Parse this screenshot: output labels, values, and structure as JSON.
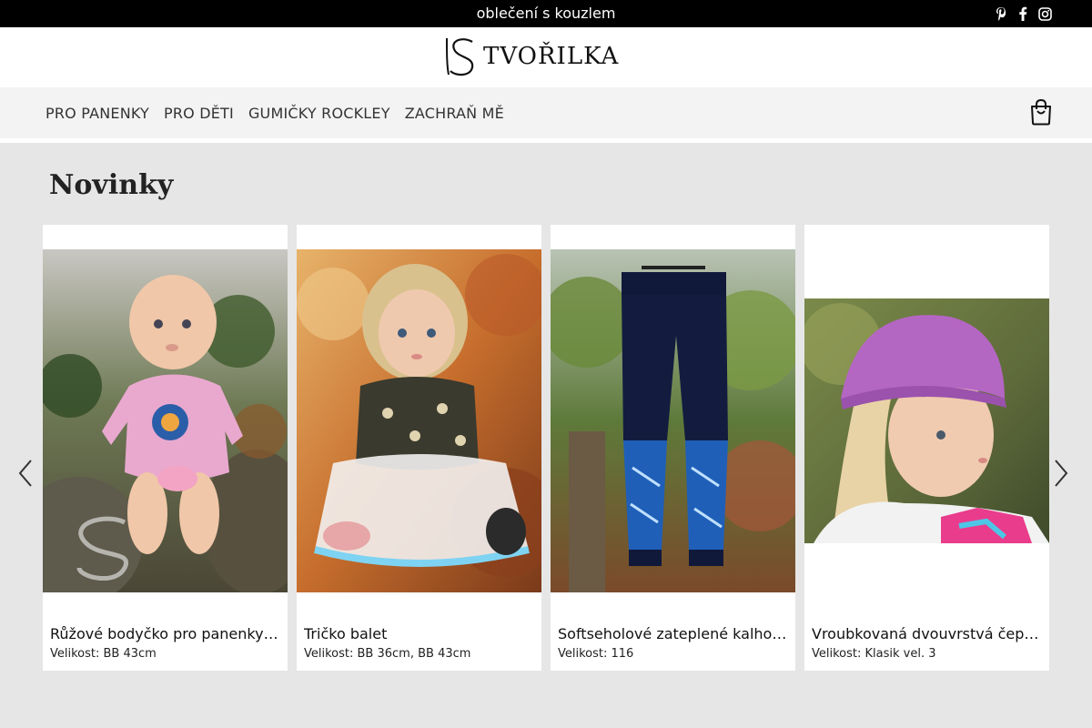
{
  "topbar": {
    "tagline": "oblečení s kouzlem",
    "social": [
      {
        "icon": "pinterest-icon"
      },
      {
        "icon": "facebook-icon"
      },
      {
        "icon": "instagram-icon"
      }
    ]
  },
  "brand": {
    "name": "TVOŘILKA"
  },
  "nav": {
    "items": [
      {
        "label": "PRO PANENKY"
      },
      {
        "label": "PRO DĚTI"
      },
      {
        "label": "GUMIČKY ROCKLEY"
      },
      {
        "label": "ZACHRAŇ MĚ"
      }
    ],
    "cart_icon": "shopping-bag-icon"
  },
  "section": {
    "title": "Novinky"
  },
  "carousel": {
    "prev_icon": "chevron-left-icon",
    "next_icon": "chevron-right-icon"
  },
  "products": [
    {
      "name": "Růžové bodyčko pro panenky…",
      "size": "Velikost: BB 43cm"
    },
    {
      "name": "Tričko balet",
      "size": "Velikost: BB 36cm, BB 43cm"
    },
    {
      "name": "Softseholové zateplené kalho…",
      "size": "Velikost: 116"
    },
    {
      "name": "Vroubkovaná dvouvrstvá čep…",
      "size": "Velikost: Klasik vel. 3"
    }
  ]
}
